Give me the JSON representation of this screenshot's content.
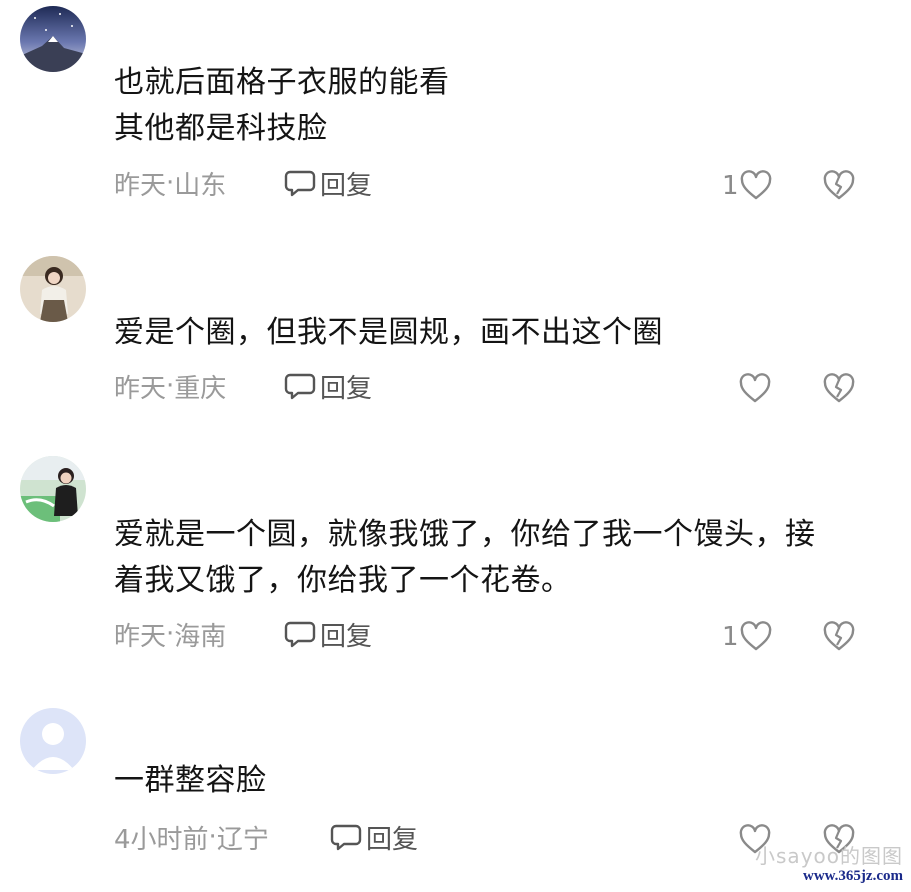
{
  "comments": [
    {
      "text": "也就后面格子衣服的能看\n其他都是科技脸",
      "time": "昨天",
      "separator": " · ",
      "location": "山东",
      "reply_label": "回复",
      "likes": "1"
    },
    {
      "text": "爱是个圈，但我不是圆规，画不出这个圈",
      "time": "昨天",
      "separator": " · ",
      "location": "重庆",
      "reply_label": "回复",
      "likes": ""
    },
    {
      "text": "爱就是一个圆，就像我饿了，你给了我一个馒头，接\n着我又饿了，你给我了一个花卷。",
      "time": "昨天",
      "separator": " · ",
      "location": "海南",
      "reply_label": "回复",
      "likes": "1"
    },
    {
      "text": "一群整容脸",
      "time": "4小时前",
      "separator": " · ",
      "location": "辽宁",
      "reply_label": "回复",
      "likes": ""
    }
  ],
  "icons": {
    "reply": "speech-bubble-icon",
    "like": "heart-outline-icon",
    "dislike": "broken-heart-icon"
  },
  "watermark": {
    "line1": "小sayoo的图图",
    "line2": "www.365jz.com"
  },
  "colors": {
    "meta": "#9a9a9a",
    "text": "#141414",
    "icon": "#8a8a8a"
  }
}
